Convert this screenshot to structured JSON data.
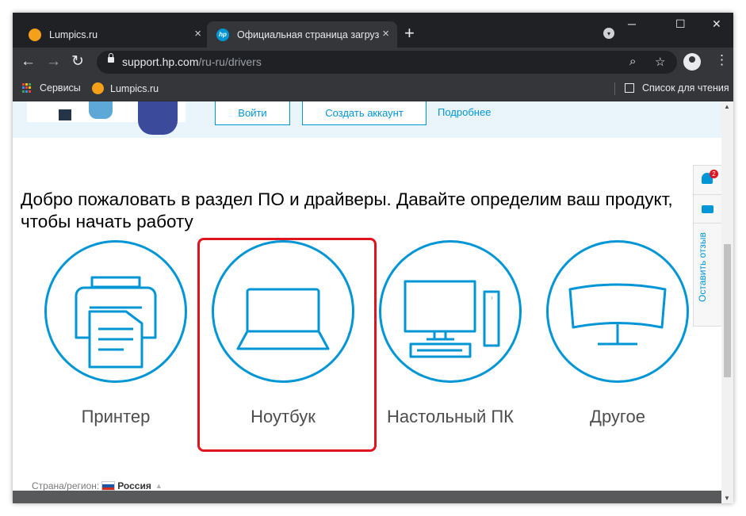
{
  "browser": {
    "tabs": [
      {
        "title": "Lumpics.ru",
        "active": false,
        "favicon": "orange-circle"
      },
      {
        "title": "Официальная страница загрузк",
        "active": true,
        "favicon": "hp-logo"
      }
    ],
    "new_tab_label": "+",
    "tab_close_glyph": "×",
    "url_host": "support.hp.com",
    "url_path": "/ru-ru/drivers",
    "bookmarks": [
      {
        "label": "Сервисы",
        "icon": "apps-grid-icon"
      },
      {
        "label": "Lumpics.ru",
        "icon": "orange-circle"
      }
    ],
    "reading_list_label": "Список для чтения"
  },
  "banner": {
    "login_label": "Войти",
    "create_account_label": "Создать аккаунт",
    "more_label": "Подробнее"
  },
  "page": {
    "welcome_text": "Добро пожаловать в раздел ПО и драйверы. Давайте определим ваш продукт, чтобы начать работу",
    "categories": [
      {
        "label": "Принтер",
        "icon": "printer-icon"
      },
      {
        "label": "Ноутбук",
        "icon": "laptop-icon",
        "highlighted": true
      },
      {
        "label": "Настольный ПК",
        "icon": "desktop-icon"
      },
      {
        "label": "Другое",
        "icon": "monitor-icon"
      }
    ],
    "region_label": "Страна/регион:",
    "country": "Россия"
  },
  "side_widget": {
    "notification_count": "2",
    "feedback_label": "Оставить отзыв"
  },
  "colors": {
    "hp_blue": "#0096d6",
    "highlight_red": "#e0141e",
    "chrome_dark": "#202124",
    "chrome_toolbar": "#35363a"
  }
}
